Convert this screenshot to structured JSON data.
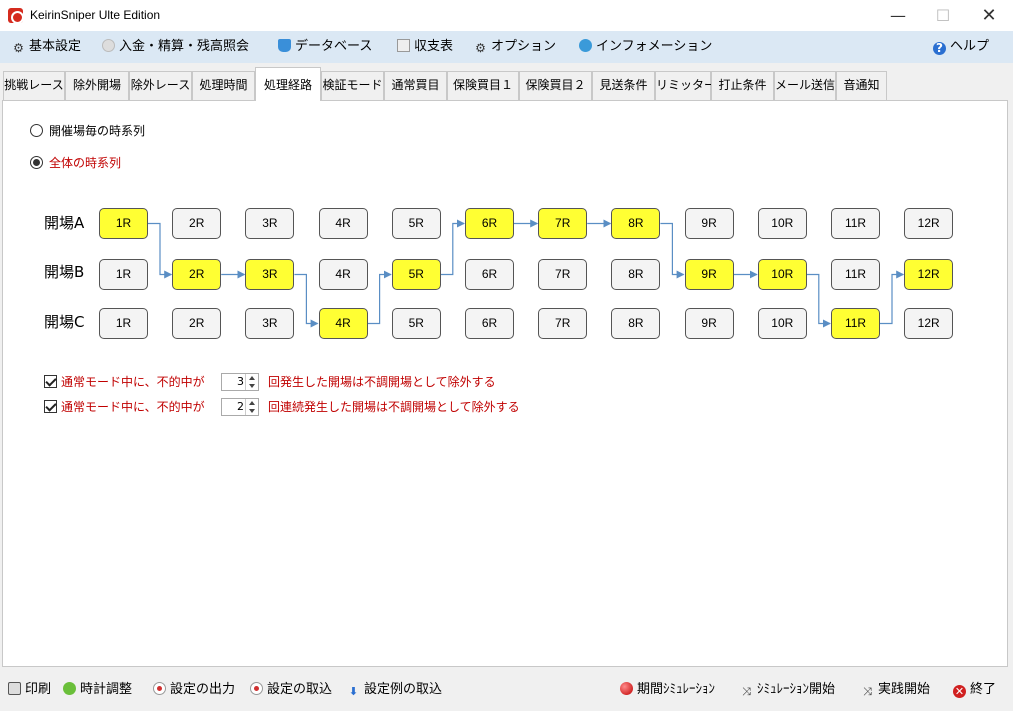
{
  "window": {
    "title": "KeirinSniper Ulte Edition",
    "minimize_glyph": "—",
    "maximize_glyph": "☐",
    "close_glyph": "✕"
  },
  "menu": [
    {
      "label": "基本設定",
      "icon": "gear-icon"
    },
    {
      "label": "入金・精算・残高照会",
      "icon": "coin-icon"
    },
    {
      "label": "データベース",
      "icon": "database-icon"
    },
    {
      "label": "収支表",
      "icon": "document-icon"
    },
    {
      "label": "オプション",
      "icon": "gear-icon"
    },
    {
      "label": "インフォメーション",
      "icon": "chat-bubble-icon"
    },
    {
      "label": "ヘルプ",
      "icon": "help-icon"
    }
  ],
  "tabs": [
    {
      "label": "挑戦レース"
    },
    {
      "label": "除外開場"
    },
    {
      "label": "除外レース"
    },
    {
      "label": "処理時間"
    },
    {
      "label": "処理経路",
      "active": true
    },
    {
      "label": "検証モード"
    },
    {
      "label": "通常買目"
    },
    {
      "label": "保険買目１"
    },
    {
      "label": "保険買目２"
    },
    {
      "label": "見送条件"
    },
    {
      "label": "リミッター"
    },
    {
      "label": "打止条件"
    },
    {
      "label": "メール送信"
    },
    {
      "label": "音通知"
    }
  ],
  "route_mode": {
    "options": [
      {
        "label": "開催場毎の時系列",
        "selected": false
      },
      {
        "label": "全体の時系列",
        "selected": true
      }
    ]
  },
  "grid": {
    "venues": [
      "開場A",
      "開場B",
      "開場C"
    ],
    "races": [
      "1R",
      "2R",
      "3R",
      "4R",
      "5R",
      "6R",
      "7R",
      "8R",
      "9R",
      "10R",
      "11R",
      "12R"
    ],
    "path_venue_index": [
      0,
      1,
      1,
      2,
      1,
      0,
      0,
      0,
      1,
      1,
      2,
      1
    ]
  },
  "options": [
    {
      "checked": true,
      "prefix": "通常モード中に、不的中が",
      "value": "3",
      "suffix": "回発生した開場は不調開場として除外する"
    },
    {
      "checked": true,
      "prefix": "通常モード中に、不的中が",
      "value": "2",
      "suffix": "回連続発生した開場は不調開場として除外する"
    }
  ],
  "bottom_left": [
    {
      "label": "印刷",
      "icon": "printer-icon"
    },
    {
      "label": "時計調整",
      "icon": "clock-icon"
    },
    {
      "label": "設定の出力",
      "icon": "record-icon"
    },
    {
      "label": "設定の取込",
      "icon": "record-icon"
    },
    {
      "label": "設定例の取込",
      "icon": "download-arrow-icon"
    }
  ],
  "bottom_right": [
    {
      "label": "期間ｼﾐｭﾚｰｼｮﾝ",
      "icon": "red-ball-icon"
    },
    {
      "label": "ｼﾐｭﾚｰｼｮﾝ開始",
      "icon": "shuffle-icon"
    },
    {
      "label": "実践開始",
      "icon": "shuffle-icon"
    },
    {
      "label": "終了",
      "icon": "exit-icon"
    }
  ],
  "colors": {
    "highlight": "#ffff33",
    "path_line": "#5a8ec4",
    "accent_red": "#c00000",
    "menubar_bg": "#dbe8f4"
  }
}
